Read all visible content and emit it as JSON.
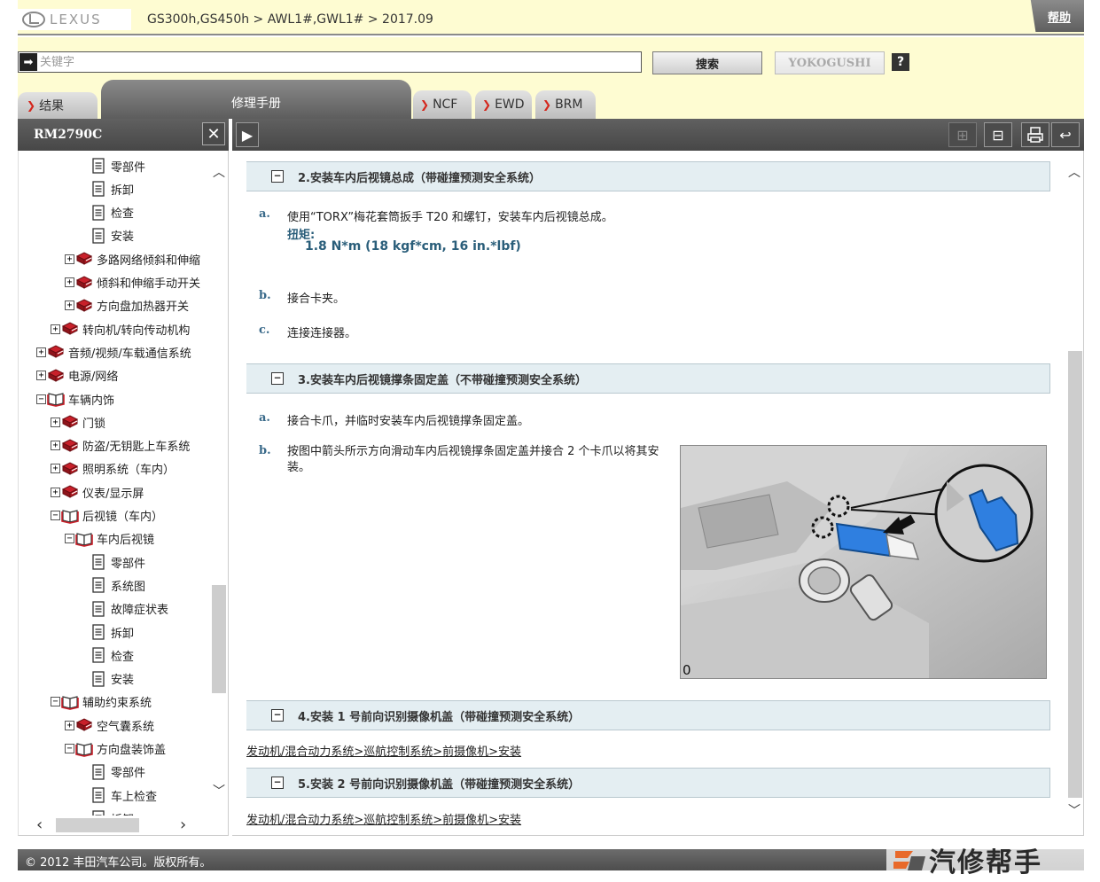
{
  "header": {
    "brand": "LEXUS",
    "breadcrumb": "GS300h,GS450h > AWL1#,GWL1# > 2017.09",
    "help": "帮助"
  },
  "search": {
    "placeholder": "关键字",
    "search_button": "搜索",
    "yokogushi_button": "YOKOGUSHI",
    "help_button": "?"
  },
  "tabs": [
    {
      "label": "结果"
    },
    {
      "label": "修理手册"
    },
    {
      "label": "NCF"
    },
    {
      "label": "EWD"
    },
    {
      "label": "BRM"
    }
  ],
  "left_panel": {
    "title": "RM2790C",
    "tree": [
      {
        "label": "零部件",
        "level": 3,
        "type": "doc",
        "toggle": ""
      },
      {
        "label": "拆卸",
        "level": 3,
        "type": "doc",
        "toggle": ""
      },
      {
        "label": "检查",
        "level": 3,
        "type": "doc",
        "toggle": ""
      },
      {
        "label": "安装",
        "level": 3,
        "type": "doc",
        "toggle": ""
      },
      {
        "label": "多路网络倾斜和伸缩",
        "level": 2,
        "type": "book-closed",
        "toggle": "+"
      },
      {
        "label": "倾斜和伸缩手动开关",
        "level": 2,
        "type": "book-closed",
        "toggle": "+"
      },
      {
        "label": "方向盘加热器开关",
        "level": 2,
        "type": "book-closed",
        "toggle": "+"
      },
      {
        "label": "转向机/转向传动机构",
        "level": 1,
        "type": "book-closed",
        "toggle": "+"
      },
      {
        "label": "音频/视频/车载通信系统",
        "level": 0,
        "type": "book-closed",
        "toggle": "+"
      },
      {
        "label": "电源/网络",
        "level": 0,
        "type": "book-closed",
        "toggle": "+"
      },
      {
        "label": "车辆内饰",
        "level": 0,
        "type": "book-open",
        "toggle": "−"
      },
      {
        "label": "门锁",
        "level": 1,
        "type": "book-closed",
        "toggle": "+"
      },
      {
        "label": "防盗/无钥匙上车系统",
        "level": 1,
        "type": "book-closed",
        "toggle": "+"
      },
      {
        "label": "照明系统（车内）",
        "level": 1,
        "type": "book-closed",
        "toggle": "+"
      },
      {
        "label": "仪表/显示屏",
        "level": 1,
        "type": "book-closed",
        "toggle": "+"
      },
      {
        "label": "后视镜（车内）",
        "level": 1,
        "type": "book-open",
        "toggle": "−"
      },
      {
        "label": "车内后视镜",
        "level": 2,
        "type": "book-open",
        "toggle": "−"
      },
      {
        "label": "零部件",
        "level": 3,
        "type": "doc",
        "toggle": ""
      },
      {
        "label": "系统图",
        "level": 3,
        "type": "doc",
        "toggle": ""
      },
      {
        "label": "故障症状表",
        "level": 3,
        "type": "doc",
        "toggle": ""
      },
      {
        "label": "拆卸",
        "level": 3,
        "type": "doc",
        "toggle": ""
      },
      {
        "label": "检查",
        "level": 3,
        "type": "doc",
        "toggle": ""
      },
      {
        "label": "安装",
        "level": 3,
        "type": "doc",
        "toggle": ""
      },
      {
        "label": "辅助约束系统",
        "level": 1,
        "type": "book-open",
        "toggle": "−"
      },
      {
        "label": "空气囊系统",
        "level": 2,
        "type": "book-closed",
        "toggle": "+"
      },
      {
        "label": "方向盘装饰盖",
        "level": 2,
        "type": "book-open",
        "toggle": "−"
      },
      {
        "label": "零部件",
        "level": 3,
        "type": "doc",
        "toggle": ""
      },
      {
        "label": "车上检查",
        "level": 3,
        "type": "doc",
        "toggle": ""
      },
      {
        "label": "拆卸",
        "level": 3,
        "type": "doc",
        "toggle": ""
      }
    ]
  },
  "content": {
    "sections": [
      {
        "title": "2.安装车内后视镜总成（带碰撞预测安全系统）"
      },
      {
        "title": "3.安装车内后视镜撑条固定盖（不带碰撞预测安全系统）"
      },
      {
        "title": "4.安装 1 号前向识别摄像机盖（带碰撞预测安全系统）"
      },
      {
        "title": "5.安装 2 号前向识别摄像机盖（带碰撞预测安全系统）"
      }
    ],
    "s2_steps": [
      {
        "letter": "a.",
        "text": "使用“TORX”梅花套筒扳手 T20 和螺钉，安装车内后视镜总成。"
      },
      {
        "letter": "b.",
        "text": "接合卡夹。"
      },
      {
        "letter": "c.",
        "text": "连接连接器。"
      }
    ],
    "torque_label": "扭矩:",
    "torque_value": "1.8 N*m (18 kgf*cm, 16 in.*lbf)",
    "s3_steps": [
      {
        "letter": "a.",
        "text": "接合卡爪，并临时安装车内后视镜撑条固定盖。"
      },
      {
        "letter": "b.",
        "text": "按图中箭头所示方向滑动车内后视镜撑条固定盖并接合 2 个卡爪以将其安装。"
      }
    ],
    "figure_code": "0",
    "link4": "发动机/混合动力系统>巡航控制系统>前摄像机>安装",
    "link5": "发动机/混合动力系统>巡航控制系统>前摄像机>安装"
  },
  "footer": {
    "copyright": "© 2012 丰田汽车公司。版权所有。",
    "watermark": "汽修帮手"
  },
  "colors": {
    "header_bg": "#fefcd2",
    "toolbar_bg": "#555555",
    "section_bg": "#e4eef2",
    "accent_red": "#d4261c",
    "torque_blue": "#2a5e7a"
  }
}
